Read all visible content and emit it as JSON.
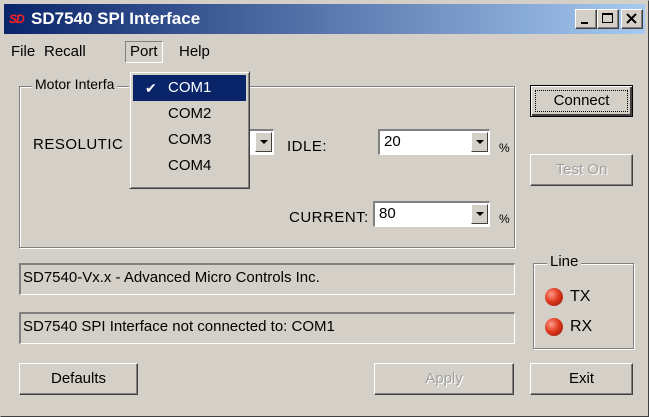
{
  "window": {
    "app_icon": "SD",
    "title": "SD7540 SPI Interface",
    "controls": [
      "minimize-icon",
      "maximize-icon",
      "close-icon"
    ]
  },
  "menubar": {
    "file": "File",
    "recall": "Recall",
    "port": "Port",
    "help": "Help"
  },
  "port_menu": {
    "items": [
      {
        "label": "COM1",
        "checked": true,
        "highlighted": true
      },
      {
        "label": "COM2",
        "checked": false
      },
      {
        "label": "COM3",
        "checked": false
      },
      {
        "label": "COM4",
        "checked": false
      }
    ],
    "check_glyph": "✔"
  },
  "motor_group": {
    "legend": "Motor Interfa",
    "resolution_label": "RESOLUTIC",
    "idle_label": "IDLE:",
    "idle_value": "20",
    "idle_unit": "%",
    "current_label": "CURRENT:",
    "current_value": "80",
    "current_unit": "%"
  },
  "status": {
    "line1": "SD7540-Vx.x - Advanced Micro Controls Inc.",
    "line2": "SD7540 SPI Interface not connected to: COM1"
  },
  "line_group": {
    "legend": "Line",
    "tx_label": "TX",
    "rx_label": "RX",
    "led_color": "#e03a1f"
  },
  "buttons": {
    "connect": "Connect",
    "test_on": "Test On",
    "defaults": "Defaults",
    "apply": "Apply",
    "exit": "Exit"
  }
}
